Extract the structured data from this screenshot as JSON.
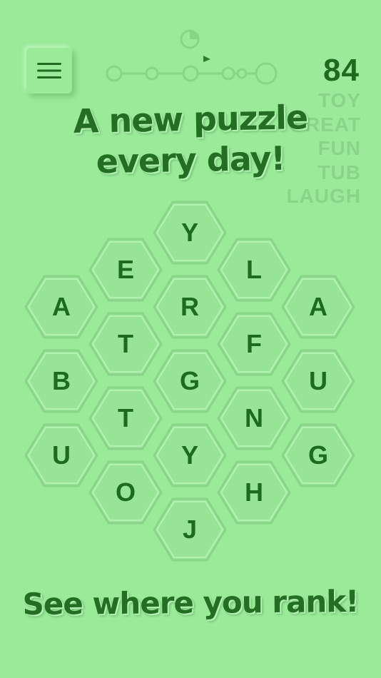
{
  "score": "84",
  "found_words": [
    "TOY",
    "GREAT",
    "FUN",
    "TUB",
    "LAUGH"
  ],
  "headline": {
    "line1": "A new puzzle",
    "line2": "every day!"
  },
  "footer": "See where you rank!",
  "board_letters": [
    "A",
    "B",
    "U",
    "E",
    "T",
    "T",
    "O",
    "Y",
    "R",
    "G",
    "Y",
    "J",
    "L",
    "F",
    "N",
    "H",
    "A",
    "U",
    "G"
  ],
  "colors": {
    "background": "#9aea9a",
    "text": "#1d6b1d",
    "faded": "#8ad48a"
  },
  "icons": {
    "menu": "hamburger-icon"
  }
}
